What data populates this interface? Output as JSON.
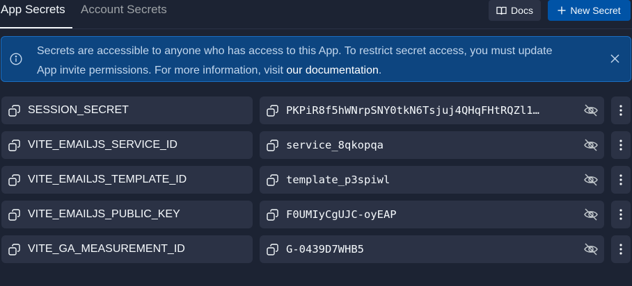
{
  "tabs": {
    "app_secrets": "App Secrets",
    "account_secrets": "Account Secrets"
  },
  "toolbar": {
    "docs_label": "Docs",
    "new_secret_label": "New Secret"
  },
  "banner": {
    "text": "Secrets are accessible to anyone who has access to this App. To restrict secret access, you must update App invite permissions. For more information, visit ",
    "link_text": "our documentation",
    "suffix": "."
  },
  "secrets": [
    {
      "key": "SESSION_SECRET",
      "value": "PKPiR8f5hWNrpSNY0tkN6Tsjuj4QHqFHtRQZl1…"
    },
    {
      "key": "VITE_EMAILJS_SERVICE_ID",
      "value": "service_8qkopqa"
    },
    {
      "key": "VITE_EMAILJS_TEMPLATE_ID",
      "value": "template_p3spiwl"
    },
    {
      "key": "VITE_EMAILJS_PUBLIC_KEY",
      "value": "F0UMIyCgUJC-oyEAP"
    },
    {
      "key": "VITE_GA_MEASUREMENT_ID",
      "value": "G-0439D7WHB5"
    }
  ],
  "colors": {
    "background": "#1c2333",
    "surface": "#2b3245",
    "accent": "#0053a6",
    "banner": "#0d4580"
  }
}
